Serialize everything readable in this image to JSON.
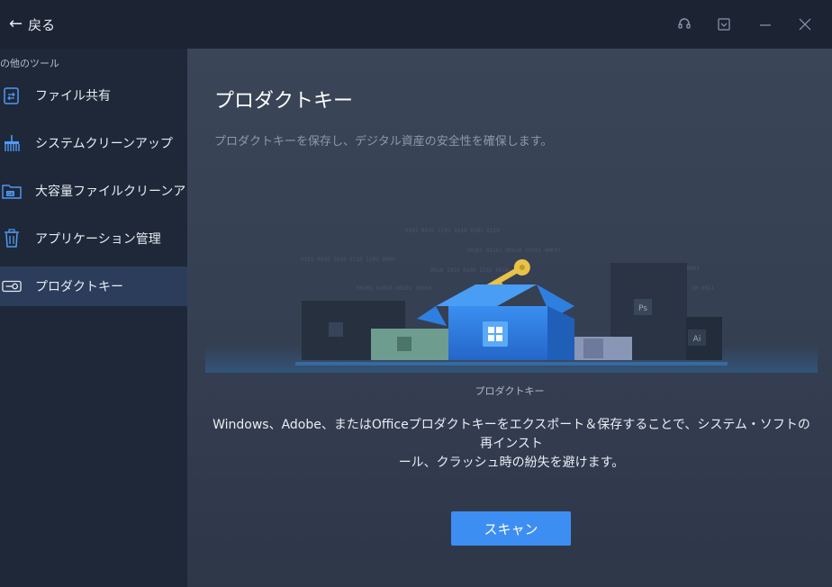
{
  "titlebar": {
    "back_label": "戻る",
    "back_icon": "arrow-left-icon",
    "controls": [
      "headset-icon",
      "dropdown-icon",
      "minimize-icon",
      "close-icon"
    ]
  },
  "sidebar": {
    "title": "の他のツール",
    "items": [
      {
        "label": "ファイル共有",
        "icon": "file-share-icon"
      },
      {
        "label": "システムクリーンアップ",
        "icon": "broom-icon"
      },
      {
        "label": "大容量ファイルクリーンアップ",
        "icon": "large-file-folder-icon"
      },
      {
        "label": "アプリケーション管理",
        "icon": "trash-icon"
      },
      {
        "label": "プロダクトキー",
        "icon": "key-icon",
        "active": true
      }
    ]
  },
  "main": {
    "title": "プロダクトキー",
    "subtitle": "プロダクトキーを保存し、デジタル資産の安全性を確保します。",
    "illustration_caption": "プロダクトキー",
    "description_line1": "Windows、Adobe、またはOfficeプロダクトキーをエクスポート＆保存することで、システム・ソフトの再インスト",
    "description_line2": "ール、クラッシュ時の紛失を避けます。",
    "scan_label": "スキャン",
    "illustration_badges": {
      "ps": "Ps",
      "ai": "Ai"
    }
  },
  "colors": {
    "accent": "#3d8ef2",
    "titlebar_bg": "#1c2433",
    "sidebar_bg": "#1e2838",
    "active_item_bg": "#2b3d5a",
    "main_bg": "#3a4558",
    "key_gold": "#e8c347"
  }
}
